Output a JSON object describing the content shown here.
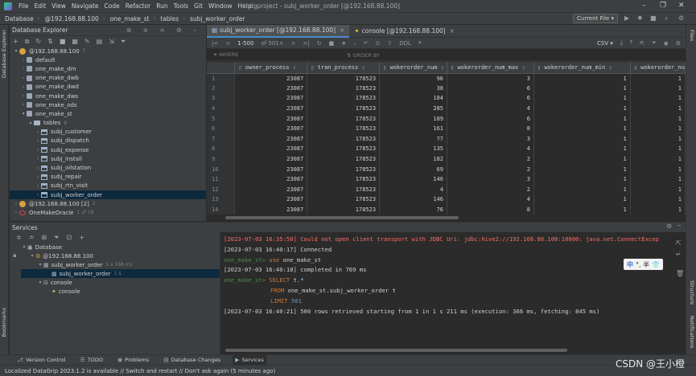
{
  "menu": [
    "File",
    "Edit",
    "View",
    "Navigate",
    "Code",
    "Refactor",
    "Run",
    "Tools",
    "Git",
    "Window",
    "Help"
  ],
  "window_title": "dgproject - subj_worker_order [@192.168.88.100]",
  "breadcrumb": [
    "Database",
    "@192.168.88.100",
    "one_make_st",
    "tables",
    "subj_worker_order"
  ],
  "run_config": "Current File",
  "left_strip_label": "Database Explorer",
  "left_strip_bottom": "Bookmarks",
  "right_strip": [
    "Files",
    "Structure",
    "Notifications"
  ],
  "db_explorer": {
    "title": "Database Explorer",
    "tree": [
      {
        "label": "@192.168.88.100",
        "badge": "7",
        "level": 0,
        "icon": "db-icon",
        "open": true
      },
      {
        "label": "default",
        "level": 1,
        "icon": "schema-icon"
      },
      {
        "label": "one_make_dm",
        "level": 1,
        "icon": "schema-icon"
      },
      {
        "label": "one_make_dwb",
        "level": 1,
        "icon": "schema-icon"
      },
      {
        "label": "one_make_dwd",
        "level": 1,
        "icon": "schema-icon"
      },
      {
        "label": "one_make_dws",
        "level": 1,
        "icon": "schema-icon"
      },
      {
        "label": "one_make_ods",
        "level": 1,
        "icon": "schema-icon"
      },
      {
        "label": "one_make_st",
        "level": 1,
        "icon": "schema-icon",
        "open": true
      },
      {
        "label": "tables",
        "badge": "8",
        "level": 2,
        "icon": "folder-icon",
        "open": true
      },
      {
        "label": "subj_customer",
        "level": 3,
        "icon": "table-icon"
      },
      {
        "label": "subj_dispatch",
        "level": 3,
        "icon": "table-icon"
      },
      {
        "label": "subj_expense",
        "level": 3,
        "icon": "table-icon"
      },
      {
        "label": "subj_install",
        "level": 3,
        "icon": "table-icon"
      },
      {
        "label": "subj_oilstation",
        "level": 3,
        "icon": "table-icon"
      },
      {
        "label": "subj_repair",
        "level": 3,
        "icon": "table-icon"
      },
      {
        "label": "subj_rtn_visit",
        "level": 3,
        "icon": "table-icon"
      },
      {
        "label": "subj_worker_order",
        "level": 3,
        "icon": "table-icon",
        "selected": true
      },
      {
        "label": "@192.168.88.100 [2]",
        "badge": "2",
        "level": 0,
        "icon": "db-icon"
      },
      {
        "label": "OneMakeOracle",
        "badge": "1 of 18",
        "level": 0,
        "icon": "oracle-icon"
      }
    ]
  },
  "editor_tabs": [
    {
      "label": "subj_worker_order [@192.168.88.100]",
      "active": true
    },
    {
      "label": "console [@192.168.88.100]",
      "active": false
    }
  ],
  "grid_toolbar": {
    "page_size": "1-500",
    "of_label": "of 501+",
    "ddl": "DDL",
    "export": "CSV"
  },
  "filter": {
    "where": "WHERE",
    "order_by": "ORDER BY"
  },
  "grid": {
    "columns": [
      "owner_process",
      "tran_process",
      "wokerorder_num",
      "wokerorder_num_max",
      "wokerorder_num_min",
      "wokerorder_nu"
    ],
    "rows": [
      [
        "1",
        "23087",
        "178523",
        "96",
        "3",
        "1",
        "1"
      ],
      [
        "2",
        "23087",
        "178523",
        "38",
        "6",
        "1",
        "1"
      ],
      [
        "3",
        "23087",
        "178523",
        "184",
        "6",
        "1",
        "1"
      ],
      [
        "4",
        "23087",
        "178523",
        "285",
        "4",
        "1",
        "1"
      ],
      [
        "5",
        "23087",
        "178523",
        "189",
        "6",
        "1",
        "1"
      ],
      [
        "6",
        "23087",
        "178523",
        "161",
        "8",
        "1",
        "1"
      ],
      [
        "7",
        "23087",
        "178523",
        "77",
        "3",
        "1",
        "1"
      ],
      [
        "8",
        "23087",
        "178523",
        "135",
        "4",
        "1",
        "1"
      ],
      [
        "9",
        "23087",
        "178523",
        "182",
        "2",
        "1",
        "1"
      ],
      [
        "10",
        "23087",
        "178523",
        "69",
        "2",
        "1",
        "1"
      ],
      [
        "11",
        "23087",
        "178523",
        "146",
        "3",
        "1",
        "1"
      ],
      [
        "12",
        "23087",
        "178523",
        "4",
        "2",
        "1",
        "1"
      ],
      [
        "13",
        "23087",
        "178523",
        "146",
        "4",
        "1",
        "1"
      ],
      [
        "14",
        "23087",
        "178523",
        "76",
        "8",
        "1",
        "1"
      ]
    ]
  },
  "services": {
    "title": "Services",
    "tree": [
      {
        "label": "Database",
        "level": 0
      },
      {
        "label": "@192.168.88.100",
        "level": 1
      },
      {
        "label": "subj_worker_order",
        "badge": "1 s 168 ms",
        "level": 2
      },
      {
        "label": "subj_worker_order",
        "badge": "1 s",
        "level": 3,
        "selected": true
      },
      {
        "label": "console",
        "level": 2
      },
      {
        "label": "console",
        "level": 3
      }
    ]
  },
  "console": {
    "lines": [
      {
        "type": "err",
        "text": "[2023-07-03 16:35:50] Could not open client transport with JDBC Uri: jdbc:hive2://192.168.88.100:10000: java.net.ConnectExcep"
      },
      {
        "type": "plain",
        "text": "[2023-07-03 16:40:17] Connected"
      },
      {
        "type": "prompt",
        "prompt": "one_make_st>",
        "kw": "use",
        "rest": " one_make_st"
      },
      {
        "type": "plain",
        "text": "[2023-07-03 16:40:18] completed in 769 ms"
      },
      {
        "type": "prompt",
        "prompt": "one_make_st>",
        "kw": "SELECT",
        "rest": " t.*"
      },
      {
        "type": "sql",
        "kw": "FROM",
        "rest": " one_make_st.subj_worker_order t"
      },
      {
        "type": "sql",
        "kw": "LIMIT",
        "rest": " ",
        "num": "501"
      },
      {
        "type": "plain",
        "text": "[2023-07-03 16:40:21] 500 rows retrieved starting from 1 in 1 s 211 ms (execution: 366 ms, fetching: 845 ms)"
      }
    ]
  },
  "ime": {
    "lang": "中",
    "rest": "°, 半"
  },
  "tool_tabs": [
    {
      "label": "Version Control",
      "icon": "branch-icon"
    },
    {
      "label": "TODO",
      "icon": "list-icon"
    },
    {
      "label": "Problems",
      "icon": "warning-icon"
    },
    {
      "label": "Database Changes",
      "icon": "db-changes-icon"
    },
    {
      "label": "Services",
      "icon": "services-icon",
      "active": true
    }
  ],
  "status": "Localized DataGrip 2023.1.2 is available // Switch and restart // Don't ask again (5 minutes ago)",
  "watermark": "CSDN @王小橙"
}
